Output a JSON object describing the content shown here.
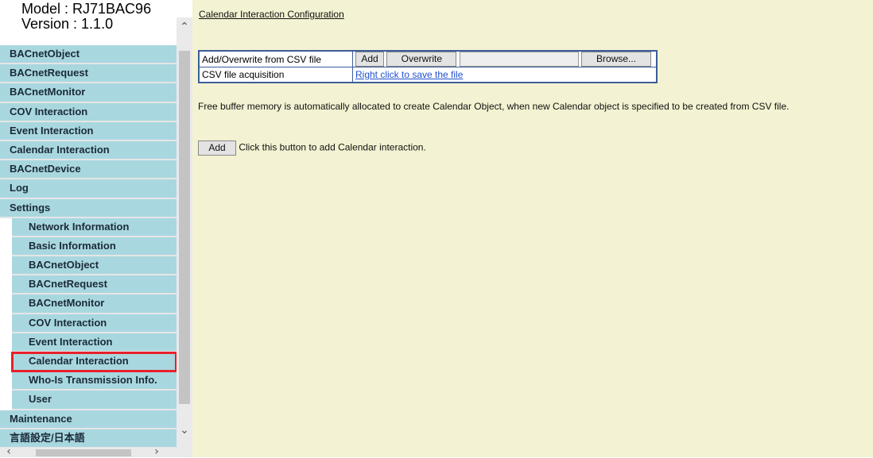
{
  "sidebar": {
    "model_line": "Model : RJ71BAC96",
    "version_line": "Version : 1.1.0",
    "items": [
      {
        "label": "BACnetObject"
      },
      {
        "label": "BACnetRequest"
      },
      {
        "label": "BACnetMonitor"
      },
      {
        "label": "COV Interaction"
      },
      {
        "label": "Event Interaction"
      },
      {
        "label": "Calendar Interaction"
      },
      {
        "label": "BACnetDevice"
      },
      {
        "label": "Log"
      },
      {
        "label": "Settings"
      },
      {
        "label": "Network Information"
      },
      {
        "label": "Basic Information"
      },
      {
        "label": "BACnetObject"
      },
      {
        "label": "BACnetRequest"
      },
      {
        "label": "BACnetMonitor"
      },
      {
        "label": "COV Interaction"
      },
      {
        "label": "Event Interaction"
      },
      {
        "label": "Calendar Interaction"
      },
      {
        "label": "Who-Is Transmission Info."
      },
      {
        "label": "User"
      },
      {
        "label": "Maintenance"
      },
      {
        "label": "言語設定/日本語"
      }
    ],
    "selected_label": "Calendar Interaction",
    "highlight_color": "#e8202a",
    "item_color": "#a9d7df"
  },
  "main": {
    "title": "Calendar Interaction Configuration",
    "csv_row_label": "Add/Overwrite from CSV file",
    "add_label": "Add",
    "overwrite_label": "Overwrite",
    "browse_label": "Browse...",
    "acq_label": "CSV file acquisition",
    "acq_link": "Right click to save the file",
    "info_text": "Free buffer memory is automatically allocated to create Calendar Object, when new Calendar object is specified to be created from CSV file.",
    "add_button_label": "Add",
    "add_hint": "Click this button to add Calendar interaction.",
    "background_color": "#f3f2d2"
  }
}
